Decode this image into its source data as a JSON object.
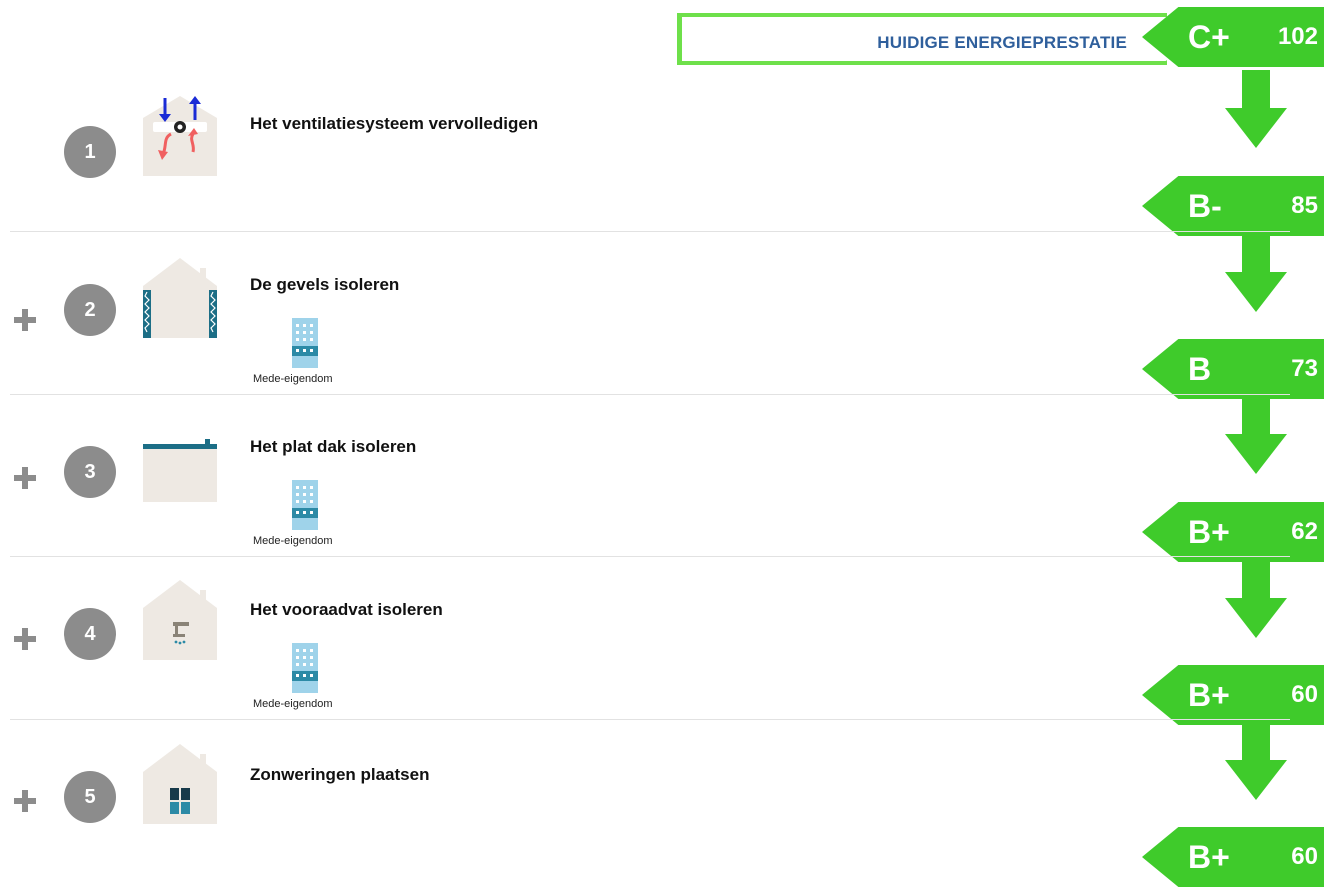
{
  "header": {
    "label": "HUIDIGE ENERGIEPRESTATIE",
    "grade": "C+",
    "score": "102"
  },
  "steps": [
    {
      "number": "1",
      "title": "Het ventilatiesysteem vervolledigen",
      "result": {
        "grade": "B-",
        "score": "85"
      }
    },
    {
      "number": "2",
      "title": "De gevels isoleren",
      "co_ownership": "Mede-eigendom",
      "result": {
        "grade": "B",
        "score": "73"
      }
    },
    {
      "number": "3",
      "title": "Het plat dak isoleren",
      "co_ownership": "Mede-eigendom",
      "result": {
        "grade": "B+",
        "score": "62"
      }
    },
    {
      "number": "4",
      "title": "Het vooraadvat isoleren",
      "co_ownership": "Mede-eigendom",
      "result": {
        "grade": "B+",
        "score": "60"
      }
    },
    {
      "number": "5",
      "title": "Zonweringen plaatsen",
      "result": {
        "grade": "B+",
        "score": "60"
      }
    }
  ],
  "colors": {
    "badge_green": "#3fcb2b",
    "header_border": "#6ee04a",
    "header_text": "#2f5f9c",
    "number_circle": "#8c8c8c",
    "house_fill": "#eee9e3"
  },
  "icons": [
    "ventilation-icon",
    "facade-insulation-icon",
    "flat-roof-icon",
    "boiler-icon",
    "sunshade-window-icon",
    "apartment-building-icon",
    "plus-icon"
  ]
}
